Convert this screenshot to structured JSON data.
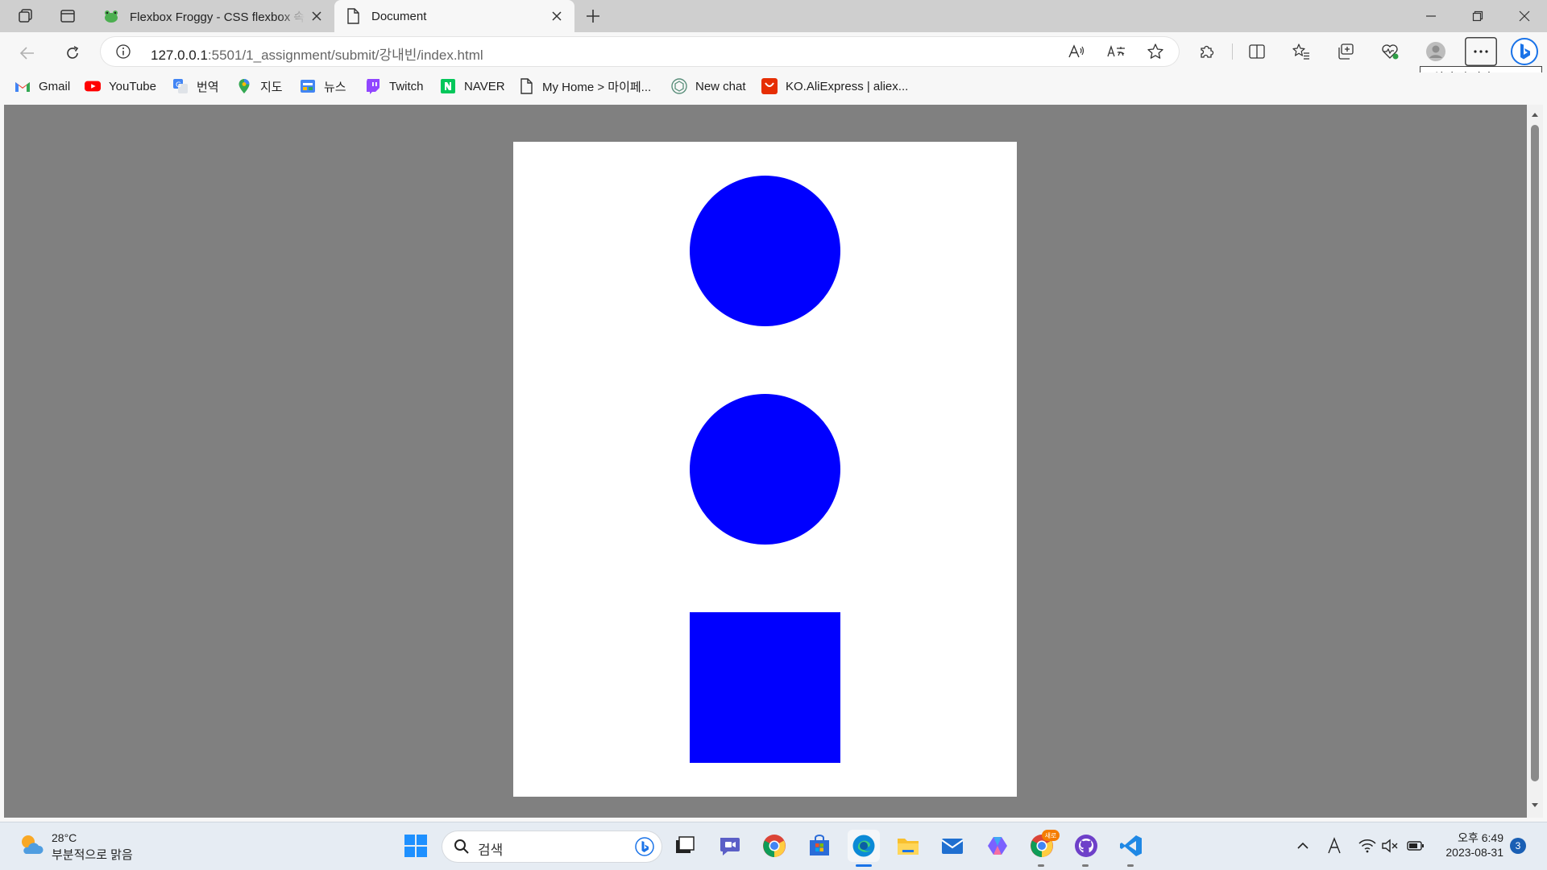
{
  "browser": {
    "tabs": [
      {
        "title": "Flexbox Froggy - CSS flexbox 속성",
        "active": false
      },
      {
        "title": "Document",
        "active": true
      }
    ],
    "address": {
      "url_host": "127.0.0.1",
      "url_rest": ":5501/1_assignment/submit/강내빈/index.html"
    },
    "tooltip": "설정 및 기타 (Alt+F)",
    "bookmarks": [
      {
        "label": "Gmail",
        "icon": "gmail-icon"
      },
      {
        "label": "YouTube",
        "icon": "youtube-icon"
      },
      {
        "label": "번역",
        "icon": "translate-icon"
      },
      {
        "label": "지도",
        "icon": "maps-icon"
      },
      {
        "label": "뉴스",
        "icon": "news-icon"
      },
      {
        "label": "Twitch",
        "icon": "twitch-icon"
      },
      {
        "label": "NAVER",
        "icon": "naver-icon"
      },
      {
        "label": "My Home > 마이페...",
        "icon": "page-icon"
      },
      {
        "label": "New chat",
        "icon": "chatgpt-icon"
      },
      {
        "label": "KO.AliExpress | aliex...",
        "icon": "aliexpress-icon"
      }
    ]
  },
  "page": {
    "background": "#808080",
    "container_color": "#ffffff",
    "shape_color": "#0000ff",
    "shapes": [
      "circle",
      "circle",
      "square"
    ]
  },
  "taskbar": {
    "weather": {
      "temp": "28°C",
      "desc": "부분적으로 맑음"
    },
    "search_label": "검색",
    "clock": {
      "time": "오후 6:49",
      "date": "2023-08-31"
    },
    "notification_count": "3",
    "chrome_badge": "새로"
  }
}
